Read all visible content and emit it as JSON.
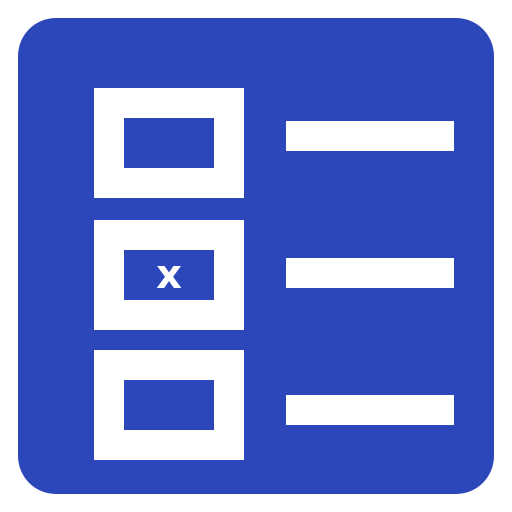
{
  "icon": {
    "name": "checklist-icon",
    "background_color": "#2b47b9",
    "foreground_color": "#ffffff"
  },
  "items": [
    {
      "checkbox": "unchecked",
      "mark": ""
    },
    {
      "checkbox": "checked",
      "mark": "x"
    },
    {
      "checkbox": "unchecked",
      "mark": ""
    }
  ]
}
